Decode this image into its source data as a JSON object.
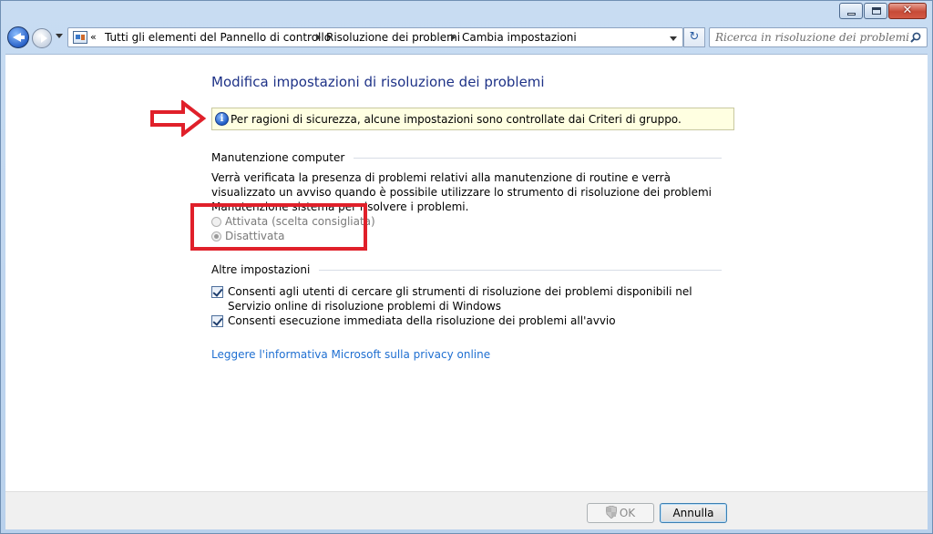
{
  "window": {
    "caption": {
      "minimize": "",
      "maximize": "",
      "close": "✕"
    }
  },
  "navigation": {
    "breadcrumb_overflow": "«",
    "breadcrumbs": [
      "Tutti gli elementi del Pannello di controllo",
      "Risoluzione dei problemi",
      "Cambia impostazioni"
    ],
    "refresh_icon": "↻",
    "search_placeholder": "Ricerca in risoluzione dei problemi"
  },
  "main": {
    "title": "Modifica impostazioni di risoluzione dei problemi",
    "info_icon": "i",
    "info_message": "Per ragioni di sicurezza, alcune impostazioni sono controllate dai Criteri di gruppo.",
    "maintenance": {
      "heading": "Manutenzione computer",
      "description": "Verrà verificata la presenza di problemi relativi alla manutenzione di routine e verrà visualizzato un avviso quando è possibile utilizzare lo strumento di risoluzione dei problemi Manutenzione sistema per risolvere i problemi.",
      "options": [
        {
          "label": "Attivata (scelta consigliata)",
          "checked": false,
          "enabled": false
        },
        {
          "label": "Disattivata",
          "checked": true,
          "enabled": false
        }
      ]
    },
    "other": {
      "heading": "Altre impostazioni",
      "checkboxes": [
        {
          "label": "Consenti agli utenti di cercare gli strumenti di risoluzione dei problemi disponibili nel Servizio online di risoluzione problemi di Windows",
          "checked": true
        },
        {
          "label": "Consenti esecuzione immediata della risoluzione dei problemi all'avvio",
          "checked": true
        }
      ]
    },
    "privacy_link": "Leggere l'informativa Microsoft sulla privacy online"
  },
  "footer": {
    "ok_label": "OK",
    "cancel_label": "Annulla"
  },
  "colors": {
    "title": "#1e3287",
    "link": "#1f6fd1",
    "info_bg": "#ffffe1",
    "annotation_red": "#e0202a"
  }
}
